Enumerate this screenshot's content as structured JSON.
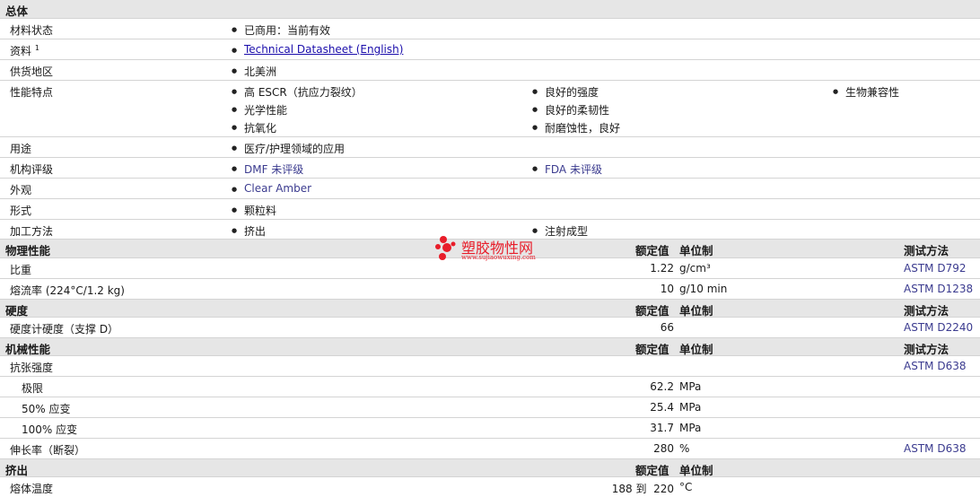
{
  "general": {
    "title": "总体",
    "material_status_label": "材料状态",
    "material_status": "已商用：当前有效",
    "docs_label": "资料",
    "docs_sup": "1",
    "docs_link": "Technical Datasheet (English)",
    "region_label": "供货地区",
    "region": "北美洲",
    "features_label": "性能特点",
    "features": [
      "高 ESCR（抗应力裂纹）",
      "良好的强度",
      "生物兼容性",
      "光学性能",
      "良好的柔韧性",
      "抗氧化",
      "耐磨蚀性，良好"
    ],
    "uses_label": "用途",
    "uses": "医疗/护理领域的应用",
    "agency_label": "机构评级",
    "agency": [
      "DMF 未评级",
      "FDA 未评级"
    ],
    "appearance_label": "外观",
    "appearance": "Clear Amber",
    "form_label": "形式",
    "form": "颗粒料",
    "process_label": "加工方法",
    "process": [
      "挤出",
      "注射成型"
    ]
  },
  "headers": {
    "value": "额定值",
    "unit": "单位制",
    "method": "测试方法"
  },
  "physical": {
    "title": "物理性能",
    "rows": [
      {
        "label": "比重",
        "value": "1.22",
        "unit": "g/cm³",
        "method": "ASTM D792"
      },
      {
        "label": "熔流率 (224°C/1.2 kg)",
        "value": "10",
        "unit": "g/10 min",
        "method": "ASTM D1238"
      }
    ]
  },
  "hardness": {
    "title": "硬度",
    "rows": [
      {
        "label": "硬度计硬度（支撑 D）",
        "value": "66",
        "unit": "",
        "method": "ASTM D2240"
      }
    ]
  },
  "mechanical": {
    "title": "机械性能",
    "tensile_label": "抗张强度",
    "tensile_method": "ASTM D638",
    "rows": [
      {
        "label": "极限",
        "value": "62.2",
        "unit": "MPa"
      },
      {
        "label": "50% 应变",
        "value": "25.4",
        "unit": "MPa"
      },
      {
        "label": "100% 应变",
        "value": "31.7",
        "unit": "MPa"
      }
    ],
    "elong_label": "伸长率（断裂）",
    "elong_value": "280",
    "elong_unit": "%",
    "elong_method": "ASTM D638"
  },
  "extrusion": {
    "title": "挤出",
    "melt_label": "熔体温度",
    "melt_value": "188 到  220",
    "melt_unit": "°C"
  },
  "watermark": {
    "name": "塑胶物性网",
    "url": "www.sujiaowuxing.com"
  }
}
